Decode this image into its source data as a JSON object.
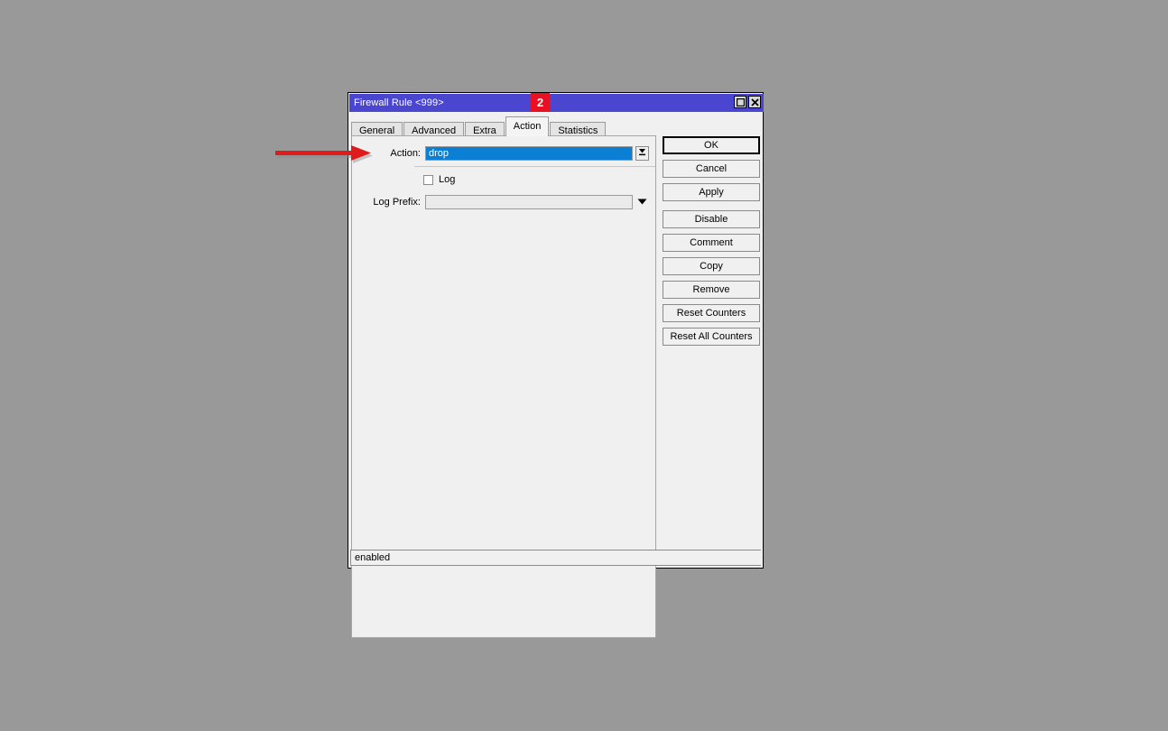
{
  "window": {
    "title": "Firewall Rule <999>",
    "controls": [
      {
        "name": "maximize-button",
        "icon": "maximize-icon"
      },
      {
        "name": "close-button",
        "icon": "close-icon"
      }
    ]
  },
  "badge": {
    "label": "2",
    "color": "#e81123"
  },
  "tabs": [
    {
      "label": "General",
      "selected": false
    },
    {
      "label": "Advanced",
      "selected": false
    },
    {
      "label": "Extra",
      "selected": false
    },
    {
      "label": "Action",
      "selected": true
    },
    {
      "label": "Statistics",
      "selected": false
    }
  ],
  "form": {
    "action": {
      "label": "Action:",
      "value": "drop",
      "placeholder": "",
      "selected": true,
      "dropdown_icon": "combo-expand-icon"
    },
    "log": {
      "label": "Log",
      "checked": false
    },
    "log_prefix": {
      "label": "Log Prefix:",
      "value": "",
      "placeholder": "",
      "dropdown_icon": "chevron-down-icon"
    }
  },
  "buttons": [
    {
      "label": "OK",
      "default": true,
      "spaced": false
    },
    {
      "label": "Cancel",
      "default": false,
      "spaced": false
    },
    {
      "label": "Apply",
      "default": false,
      "spaced": false
    },
    {
      "label": "Disable",
      "default": false,
      "spaced": true
    },
    {
      "label": "Comment",
      "default": false,
      "spaced": false
    },
    {
      "label": "Copy",
      "default": false,
      "spaced": false
    },
    {
      "label": "Remove",
      "default": false,
      "spaced": false
    },
    {
      "label": "Reset Counters",
      "default": false,
      "spaced": false
    },
    {
      "label": "Reset All Counters",
      "default": false,
      "spaced": false
    }
  ],
  "statusbar": {
    "text": "enabled"
  },
  "annotation": {
    "arrow_color": "#e01b1b",
    "points_to": "action-input"
  },
  "colors": {
    "titlebar": "#4b46cf",
    "desktop": "#999999",
    "selection": "#0a7fd4",
    "badge": "#e81123"
  }
}
